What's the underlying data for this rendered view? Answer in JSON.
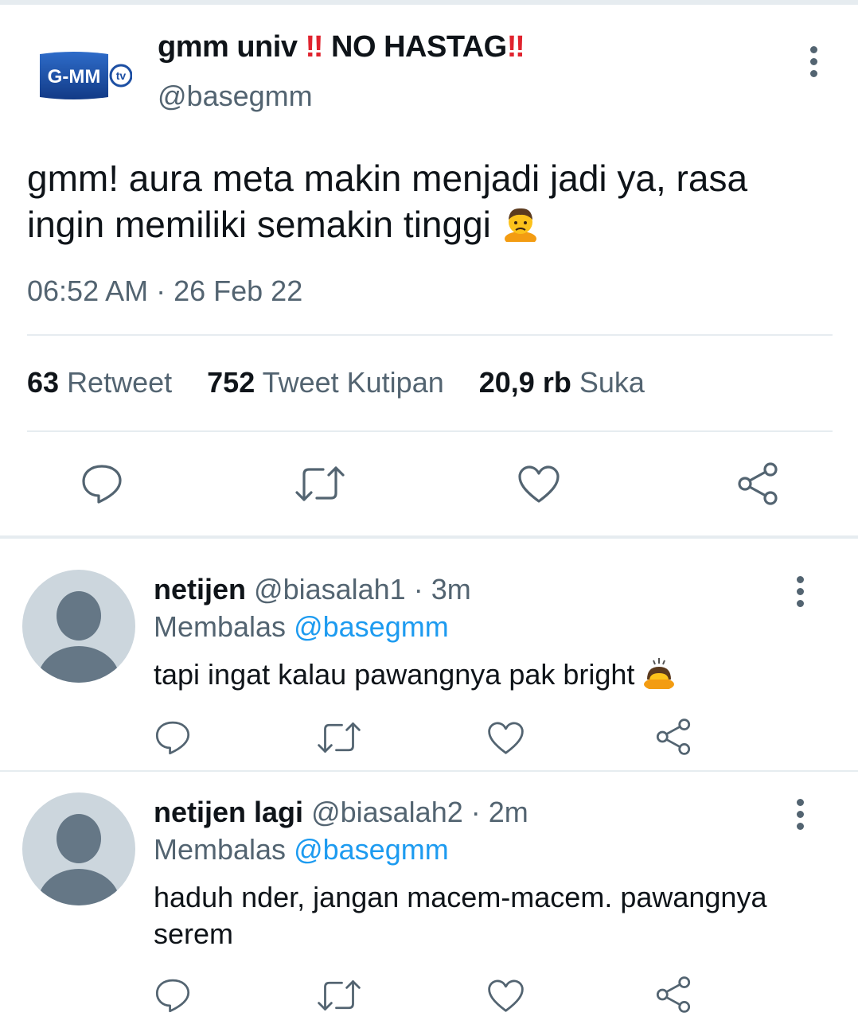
{
  "tweet": {
    "display_name_prefix": "gmm univ",
    "display_name_mark_1": "‼",
    "display_name_middle": "NO HASTAG",
    "display_name_mark_2": "‼",
    "handle": "@basegmm",
    "logo_text": "G-MM",
    "logo_badge": "tv",
    "text": "gmm! aura meta makin menjadi jadi ya, rasa ingin memiliki semakin tinggi",
    "emoji": "person-frowning",
    "timestamp": "06:52 AM · 26 Feb 22",
    "stats": {
      "retweets_count": "63",
      "retweets_label": "Retweet",
      "quotes_count": "752",
      "quotes_label": "Tweet Kutipan",
      "likes_count": "20,9 rb",
      "likes_label": "Suka"
    }
  },
  "replies": [
    {
      "name": "netijen",
      "handle": "@biasalah1",
      "time": "· 3m",
      "replying_label": "Membalas",
      "replying_to": "@basegmm",
      "text": "tapi ingat kalau pawangnya pak bright",
      "emoji": "person-bowing"
    },
    {
      "name": "netijen lagi",
      "handle": "@biasalah2",
      "time": "· 2m",
      "replying_label": "Membalas",
      "replying_to": "@basegmm",
      "text": "haduh nder, jangan macem-macem. pawangnya serem"
    }
  ],
  "colors": {
    "text": "#0f1419",
    "muted": "#536471",
    "link": "#1d9bf0",
    "divider": "#e6ecf0",
    "avatar_bg": "#ccd6dd",
    "logo_blue": "#1d4fa3",
    "exclaim_red": "#e0232e"
  },
  "icons": [
    "reply-icon",
    "retweet-icon",
    "like-icon",
    "share-icon",
    "more-icon"
  ]
}
